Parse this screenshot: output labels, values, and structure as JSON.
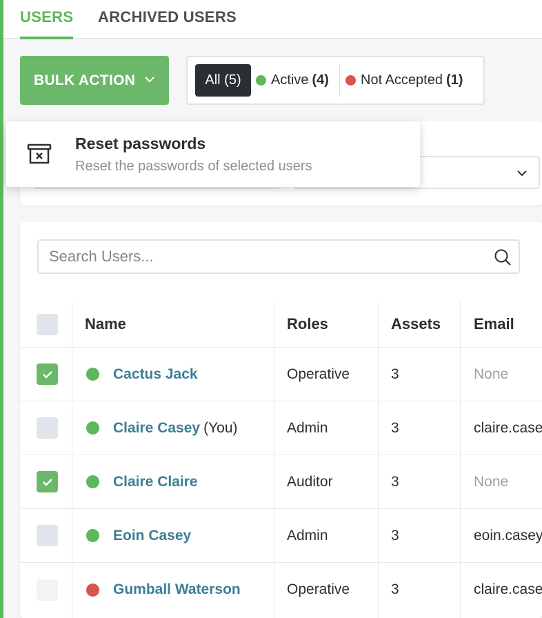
{
  "tabs": [
    {
      "label": "USERS",
      "active": true
    },
    {
      "label": "ARCHIVED USERS",
      "active": false
    }
  ],
  "toolbar": {
    "bulk_action_label": "BULK ACTION",
    "filters": {
      "all": {
        "label": "All",
        "count": "(5)"
      },
      "active": {
        "label": "Active",
        "count": "(4)",
        "color": "#5cb85c"
      },
      "not_accepted": {
        "label": "Not Accepted",
        "count": "(1)",
        "color": "#d9534f"
      }
    }
  },
  "bulk_menu": {
    "items": [
      {
        "icon": "archive-box-x-icon",
        "title": "Reset passwords",
        "description": "Reset the passwords of selected users"
      }
    ]
  },
  "search": {
    "placeholder": "Search Users..."
  },
  "table": {
    "headers": {
      "name": "Name",
      "roles": "Roles",
      "assets": "Assets",
      "email": "Email"
    },
    "rows": [
      {
        "checked": true,
        "status": "active",
        "name": "Cactus Jack",
        "suffix": "",
        "role": "Operative",
        "assets": "3",
        "email": "None"
      },
      {
        "checked": false,
        "status": "active",
        "name": "Claire Casey",
        "suffix": "(You)",
        "role": "Admin",
        "assets": "3",
        "email": "claire.case"
      },
      {
        "checked": true,
        "status": "active",
        "name": "Claire Claire",
        "suffix": "",
        "role": "Auditor",
        "assets": "3",
        "email": "None"
      },
      {
        "checked": false,
        "status": "active",
        "name": "Eoin Casey",
        "suffix": "",
        "role": "Admin",
        "assets": "3",
        "email": "eoin.casey"
      },
      {
        "checked": false,
        "status": "not_accepted",
        "name": "Gumball Waterson",
        "suffix": "",
        "role": "Operative",
        "assets": "3",
        "email": "claire.case"
      }
    ]
  },
  "colors": {
    "accent": "#5cb85c",
    "button": "#6bb86a",
    "link": "#3b7f96",
    "active_dot": "#5cb85c",
    "not_accepted_dot": "#d9534f"
  }
}
